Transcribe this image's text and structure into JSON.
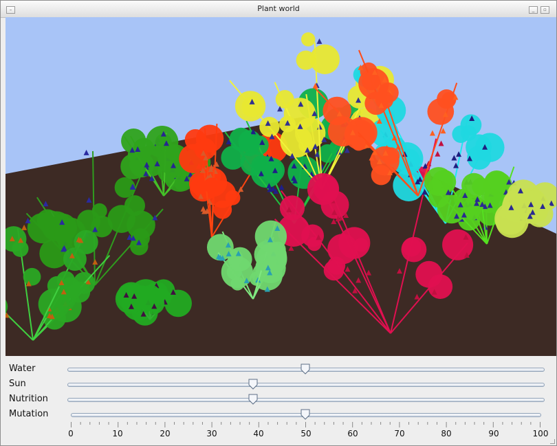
{
  "window": {
    "title": "Plant world"
  },
  "icons": {
    "menu": "window-menu-icon",
    "minimize": "minimize-icon",
    "close": "close-icon"
  },
  "scene": {
    "sky_color": "#a8c4f7",
    "ground_color": "#3d2a24",
    "description_shapes": "plants"
  },
  "sliders": [
    {
      "label": "Water",
      "value": 50
    },
    {
      "label": "Sun",
      "value": 39
    },
    {
      "label": "Nutrition",
      "value": 39
    },
    {
      "label": "Mutation",
      "value": 50
    }
  ],
  "scale": {
    "min": 0,
    "max": 100,
    "labels": [
      "0",
      "10",
      "20",
      "30",
      "40",
      "50",
      "60",
      "70",
      "80",
      "90",
      "100"
    ]
  }
}
